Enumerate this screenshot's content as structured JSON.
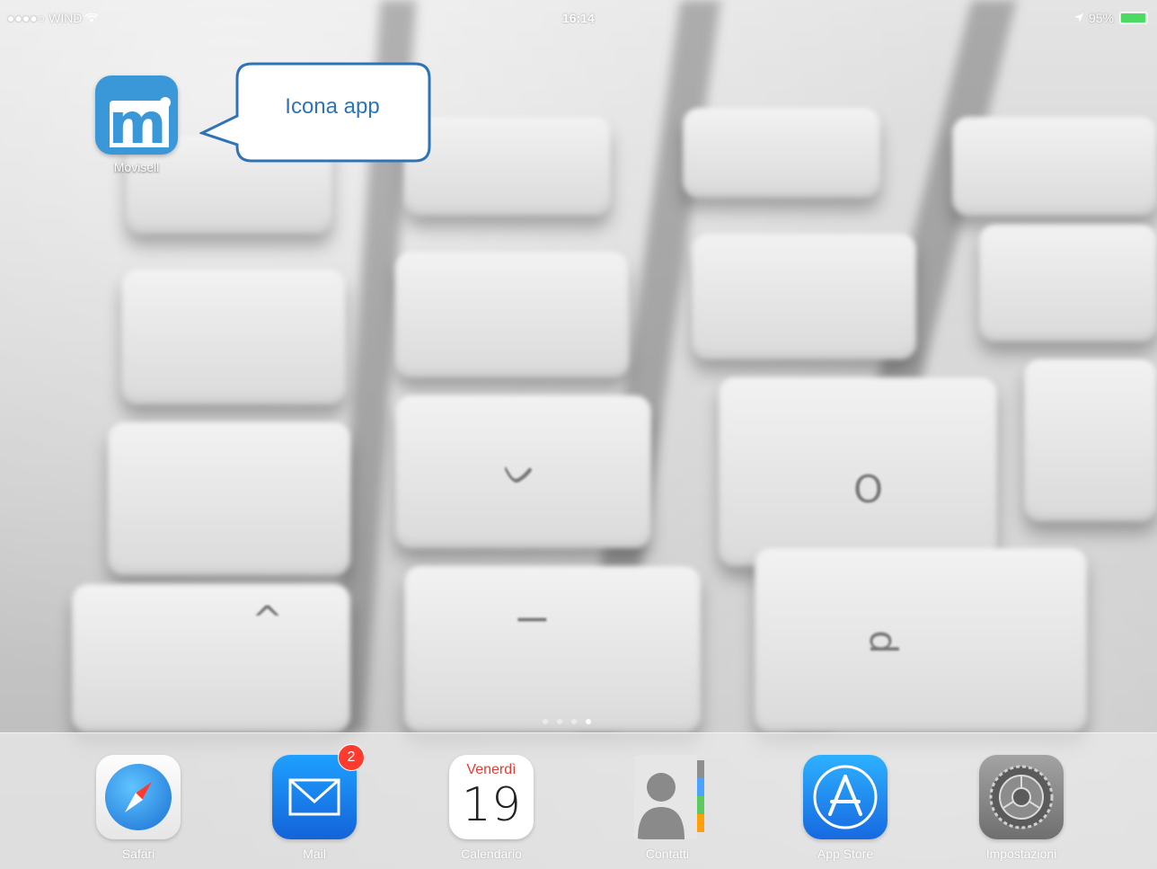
{
  "status_bar": {
    "carrier": "●●●●○ WIND",
    "time": "16:14",
    "battery_text": "95%",
    "battery_level": 0.95
  },
  "home_screen": {
    "apps": [
      {
        "label": "Movisell",
        "icon": "movisell-m-icon",
        "color": "#3a97d8"
      }
    ],
    "page_indicator": {
      "pages": 4,
      "active_index": 3
    }
  },
  "callout": {
    "text": "Icona app",
    "border_color": "#2e74b5"
  },
  "dock": {
    "items": [
      {
        "label": "Safari",
        "icon": "compass-icon"
      },
      {
        "label": "Mail",
        "icon": "envelope-icon",
        "badge": "2"
      },
      {
        "label": "Calendario",
        "icon": "calendar-icon",
        "day_name": "Venerdì",
        "day_number": "19"
      },
      {
        "label": "Contatti",
        "icon": "contacts-icon"
      },
      {
        "label": "App Store",
        "icon": "app-store-icon"
      },
      {
        "label": "Impostazioni",
        "icon": "gear-icon"
      }
    ]
  }
}
